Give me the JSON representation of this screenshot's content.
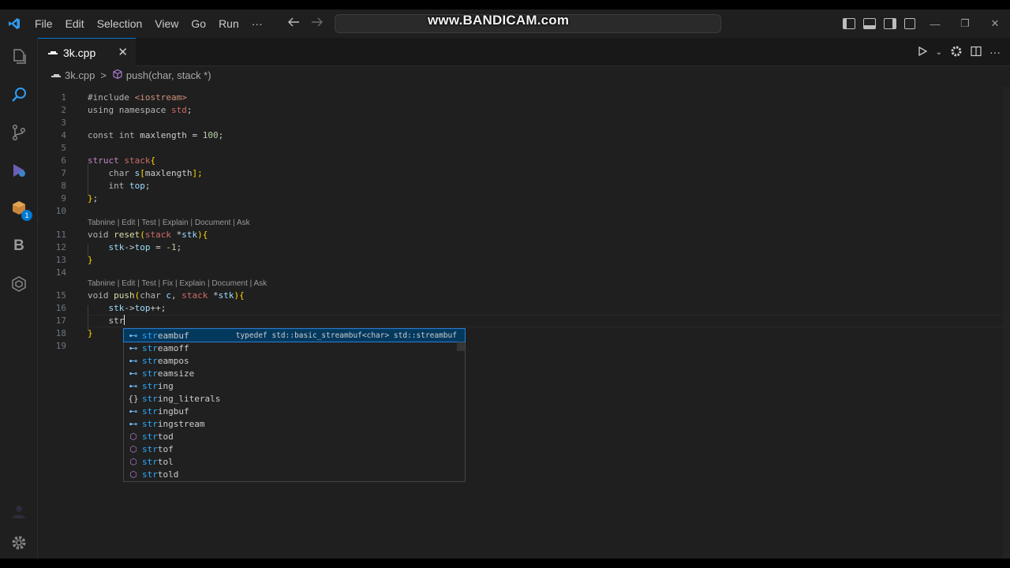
{
  "watermark": "www.BANDICAM.com",
  "menu": [
    "File",
    "Edit",
    "Selection",
    "View",
    "Go",
    "Run",
    "···"
  ],
  "activity_badge": "1",
  "tab": {
    "label": "3k.cpp",
    "close": "✕"
  },
  "breadcrumb": {
    "file": "3k.cpp",
    "sep": ">",
    "symbol": "push(char, stack *)"
  },
  "codelens": {
    "reset": "Tabnine | Edit | Test | Explain | Document | Ask",
    "push": "Tabnine | Edit | Test | Fix | Explain | Document | Ask"
  },
  "line_numbers": [
    "1",
    "2",
    "3",
    "4",
    "5",
    "6",
    "7",
    "8",
    "9",
    "10",
    "11",
    "12",
    "13",
    "14",
    "15",
    "16",
    "17",
    "18",
    "19"
  ],
  "code": {
    "l1a": "#include ",
    "l1b": "<iostream>",
    "l2a": "using namespace ",
    "l2b": "std",
    "l2c": ";",
    "l4a": "const int ",
    "l4b": "maxlength",
    "l4c": " = ",
    "l4d": "100",
    "l4e": ";",
    "l6a": "struct ",
    "l6b": "stack",
    "l6c": "{",
    "l7a": "    char ",
    "l7b": "s",
    "l7c": "[",
    "l7d": "maxlength",
    "l7e": "];",
    "l8a": "    int ",
    "l8b": "top",
    "l8c": ";",
    "l9a": "}",
    "l9b": ";",
    "l11a": "void ",
    "l11b": "reset",
    "l11c": "(",
    "l11d": "stack",
    "l11e": " *",
    "l11f": "stk",
    "l11g": "){",
    "l12a": "    stk",
    "l12b": "->",
    "l12c": "top",
    "l12d": " = ",
    "l12e": "-1",
    "l12f": ";",
    "l13a": "}",
    "l15a": "void ",
    "l15b": "push",
    "l15c": "(",
    "l15d": "char ",
    "l15e": "c",
    "l15f": ", ",
    "l15g": "stack",
    "l15h": " *",
    "l15i": "stk",
    "l15j": "){",
    "l16a": "    stk",
    "l16b": "->",
    "l16c": "top",
    "l16d": "++;",
    "l17a": "    str",
    "l18a": "}"
  },
  "suggestions": [
    {
      "kind": "class",
      "icon": "⊷",
      "match": "str",
      "rest": "eambuf",
      "detail": "typedef std::basic_streambuf<char> std::streambuf"
    },
    {
      "kind": "class",
      "icon": "⊷",
      "match": "str",
      "rest": "eamoff",
      "detail": ""
    },
    {
      "kind": "class",
      "icon": "⊷",
      "match": "str",
      "rest": "eampos",
      "detail": ""
    },
    {
      "kind": "class",
      "icon": "⊷",
      "match": "str",
      "rest": "eamsize",
      "detail": ""
    },
    {
      "kind": "class",
      "icon": "⊷",
      "match": "str",
      "rest": "ing",
      "detail": ""
    },
    {
      "kind": "namespace",
      "icon": "{}",
      "match": "str",
      "rest": "ing_literals",
      "detail": ""
    },
    {
      "kind": "class",
      "icon": "⊷",
      "match": "str",
      "rest": "ingbuf",
      "detail": ""
    },
    {
      "kind": "class",
      "icon": "⊷",
      "match": "str",
      "rest": "ingstream",
      "detail": ""
    },
    {
      "kind": "function",
      "icon": "⬡",
      "match": "str",
      "rest": "tod",
      "detail": ""
    },
    {
      "kind": "function",
      "icon": "⬡",
      "match": "str",
      "rest": "tof",
      "detail": ""
    },
    {
      "kind": "function",
      "icon": "⬡",
      "match": "str",
      "rest": "tol",
      "detail": ""
    },
    {
      "kind": "function",
      "icon": "⬡",
      "match": "str",
      "rest": "told",
      "detail": ""
    }
  ],
  "colors": {
    "accent": "#0078d4",
    "background": "#1f1f1f",
    "selection": "#04395e",
    "match": "#2aaaff"
  }
}
